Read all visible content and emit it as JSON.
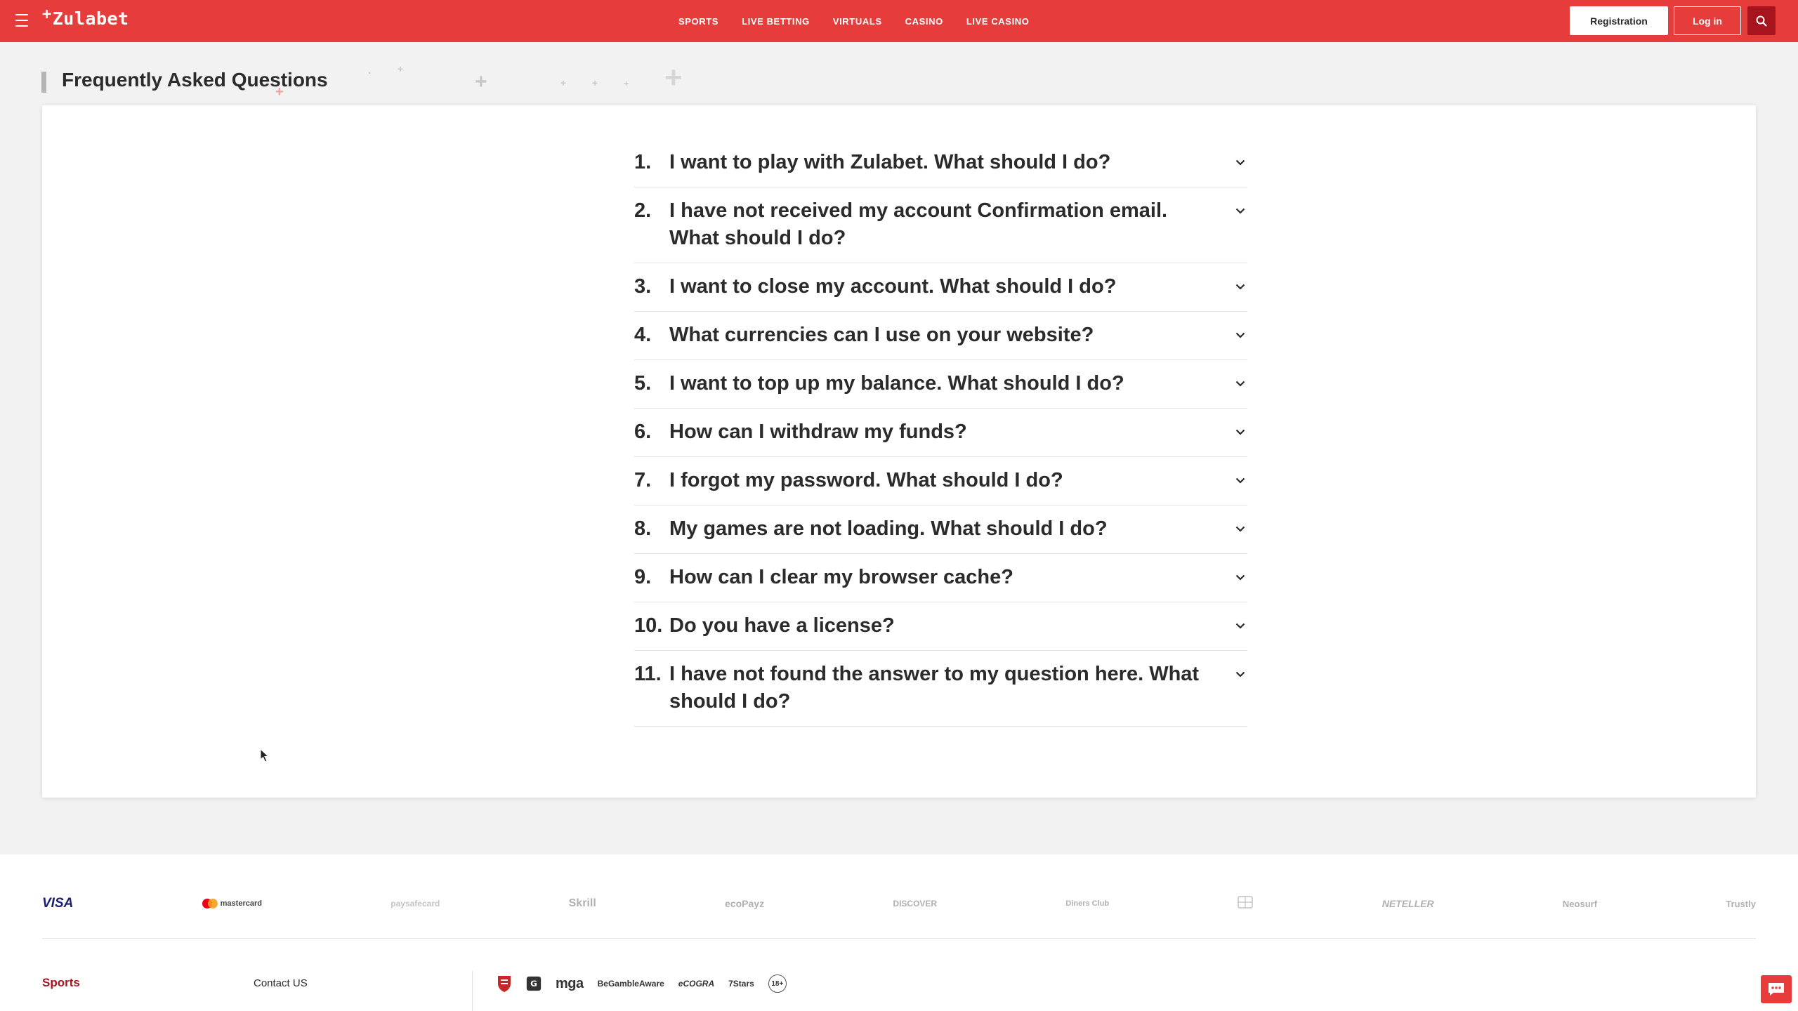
{
  "header": {
    "logo_text": "Zulabet",
    "logo_plus": "+",
    "nav": [
      "SPORTS",
      "LIVE BETTING",
      "VIRTUALS",
      "CASINO",
      "LIVE CASINO"
    ],
    "registration_label": "Registration",
    "login_label": "Log in",
    "accent_color": "#e63c3c"
  },
  "page": {
    "title": "Frequently Asked Questions"
  },
  "faq": [
    {
      "num": "1.",
      "question": "I want to play with Zulabet. What should I do?"
    },
    {
      "num": "2.",
      "question": "I have not received my account Confirmation email. What should I do?"
    },
    {
      "num": "3.",
      "question": "I want to close my account. What should I do?"
    },
    {
      "num": "4.",
      "question": "What currencies can I use on your website?"
    },
    {
      "num": "5.",
      "question": "I want to top up my balance. What should I do?"
    },
    {
      "num": "6.",
      "question": "How can I withdraw my funds?"
    },
    {
      "num": "7.",
      "question": "I forgot my password. What should I do?"
    },
    {
      "num": "8.",
      "question": "My games are not loading. What should I do?"
    },
    {
      "num": "9.",
      "question": "How can I clear my browser cache?"
    },
    {
      "num": "10.",
      "question": "Do you have a license?"
    },
    {
      "num": "11.",
      "question": "I have not found the answer to my question here. What should I do?"
    }
  ],
  "footer": {
    "payments": [
      "VISA",
      "mastercard",
      "paysafecard",
      "Skrill",
      "ecoPayz",
      "DISCOVER",
      "Diners Club",
      "",
      "NETELLER",
      "Neosurf",
      "Trustly"
    ],
    "sports_link": "Sports",
    "contact_link": "Contact US",
    "licenses": [
      "mga",
      "BeGambleAware",
      "eCOGRA",
      "7Stars",
      "18+"
    ]
  }
}
